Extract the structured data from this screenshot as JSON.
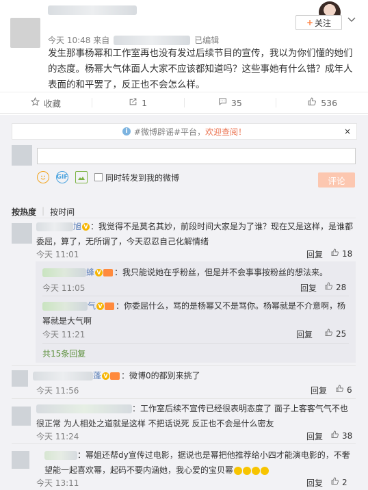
{
  "post": {
    "follow_label": "关注",
    "time": "今天 10:48 来自",
    "edited": "已编辑",
    "text": "发生那事杨幂和工作室再也没有发过后续节目的宣传，我以为你们懂的她们的态度。杨幂大气体面人大家不应该都知道吗？这些事她有什么错？成年人表面的和平罢了，反正也不会怎么样。"
  },
  "actions": {
    "collect": "收藏",
    "forward": "1",
    "comment": "35",
    "like": "536"
  },
  "notice": {
    "text": "#微博辟谣#平台，",
    "link": "欢迎查阅！",
    "close": "×"
  },
  "composer": {
    "forward_label": "同时转发到我的微博",
    "submit": "评论"
  },
  "sort": {
    "hot": "按热度",
    "time": "按时间"
  },
  "comments": [
    {
      "name_tail": "旭",
      "text": "：我觉得不是莫名其妙，前段时间大家是为了谁？现在又是这样，是谁都委屈，算了，无所谓了，今天忍忍自己化解情绪",
      "time": "今天 11:01",
      "reply": "回复",
      "likes": "18"
    },
    {
      "name_tail": "蜂",
      "text": "：我只能说她在乎粉丝，但是并不会事事按粉丝的想法来。",
      "time": "今天 11:05",
      "reply": "回复",
      "likes": "28"
    },
    {
      "name_tail": "气",
      "text": "：你委屈什么，骂的是杨幂又不是骂你。杨幂就是不介意啊，杨幂就是大气啊",
      "time": "今天 11:21",
      "reply": "回复",
      "likes": "25"
    },
    {
      "more": "共15条回复"
    },
    {
      "name_tail": "蓬",
      "text": "：微博0的都别来挑了",
      "time": "今天 11:56",
      "reply": "回复",
      "likes": "6"
    },
    {
      "text": "：工作室后续不宣传已经很表明态度了 面子上客客气气不也很正常 为人相处之道就是这样 不把话说死 反正也不会是什么密友",
      "time": "今天 11:24",
      "reply": "回复",
      "likes": "38"
    },
    {
      "text": "：幂姐还帮dy宣传过电影，据说也是幂把他推荐给小四才能演电影的，不奢望能一起喜欢幂，起码不要内涵她，我心爱的宝贝幂",
      "time": "今天 13:11",
      "reply": "回复",
      "likes": "2"
    }
  ],
  "colors": {
    "accent": "#eb7350",
    "link_blue": "#5b7fb8",
    "submit_bg": "#fcc7b0",
    "vip_gold": "#f7b500"
  },
  "icons": [
    "star-icon",
    "forward-icon",
    "comment-icon",
    "thumb-up-icon",
    "info-icon",
    "emoji-icon",
    "gif-icon",
    "image-icon",
    "chevron-down-icon"
  ]
}
